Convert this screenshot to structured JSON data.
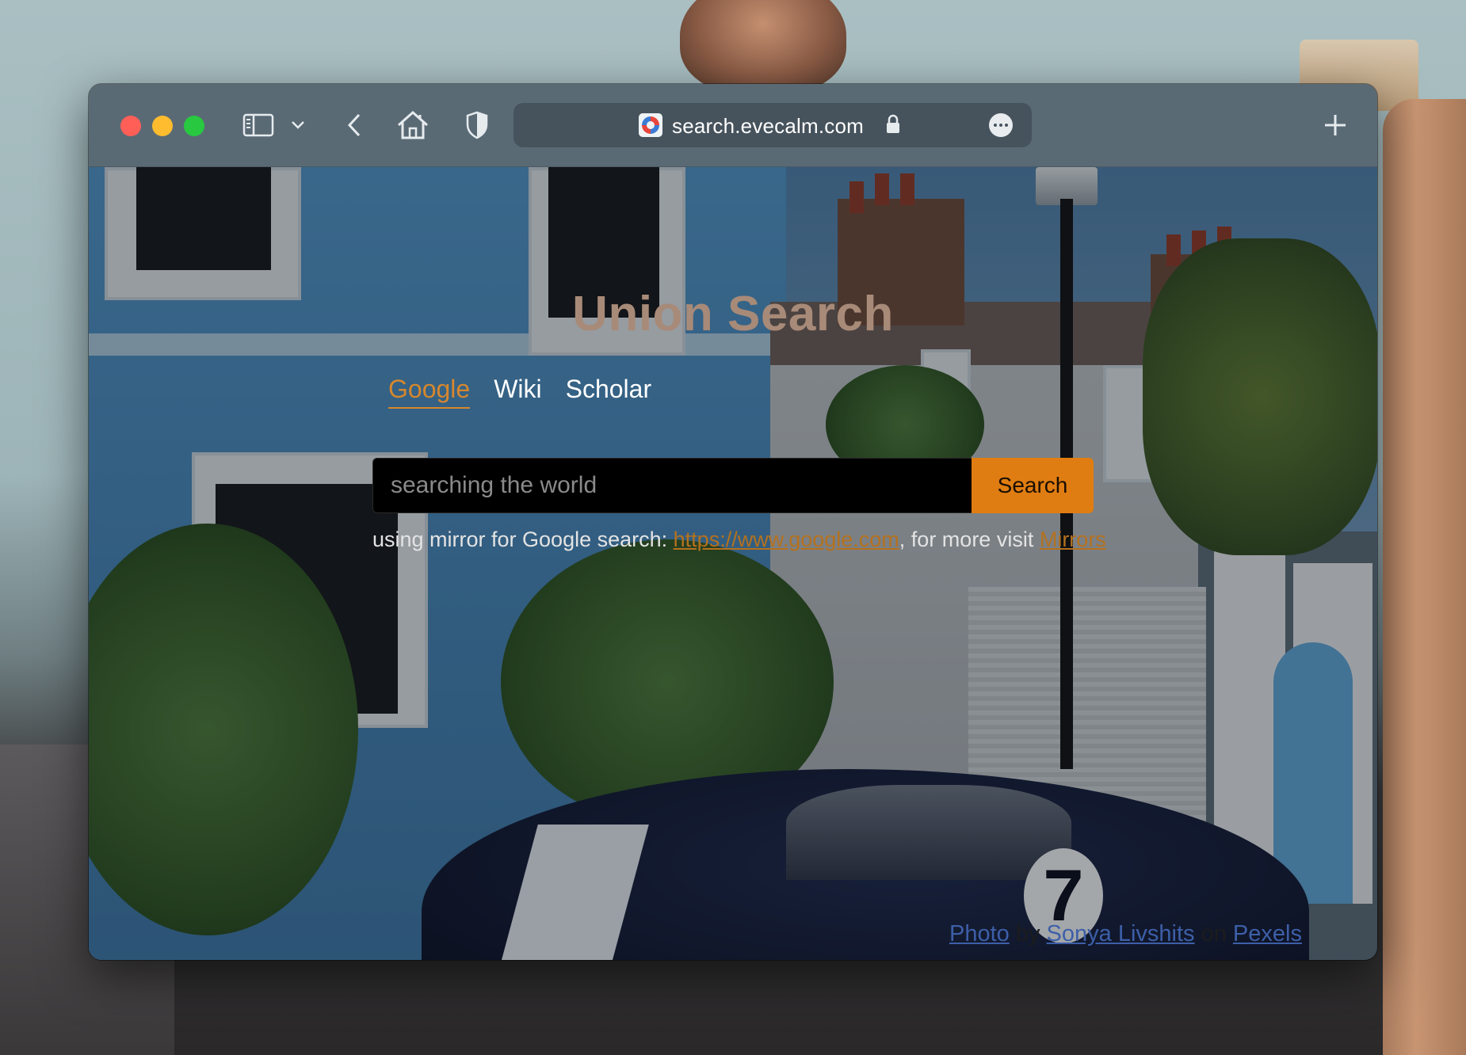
{
  "browser": {
    "url": "search.evecalm.com",
    "icons": {
      "sidebar": "sidebar-icon",
      "sidebar_menu": "chevron-down-icon",
      "back": "chevron-left-icon",
      "home": "home-icon",
      "privacy": "shield-icon",
      "lock": "lock-icon",
      "more": "more-icon",
      "new_tab": "plus-icon"
    }
  },
  "page": {
    "title": "Union Search",
    "tabs": [
      {
        "label": "Google",
        "active": true
      },
      {
        "label": "Wiki",
        "active": false
      },
      {
        "label": "Scholar",
        "active": false
      }
    ],
    "search": {
      "placeholder": "searching the world",
      "value": "",
      "button_label": "Search"
    },
    "mirror_note": {
      "prefix": "using mirror for Google search: ",
      "link": "https://www.google.com",
      "middle": ", for more visit ",
      "more_link": "Mirrors"
    },
    "credit": {
      "photo_link": "Photo",
      "by": " by ",
      "author_link": "Sonya Livshits",
      "on": " on ",
      "source_link": "Pexels"
    }
  },
  "colors": {
    "accent": "#e07d12",
    "active_tab": "#d6872d",
    "title": "#a88a78",
    "toolbar": "#5a6a75"
  }
}
